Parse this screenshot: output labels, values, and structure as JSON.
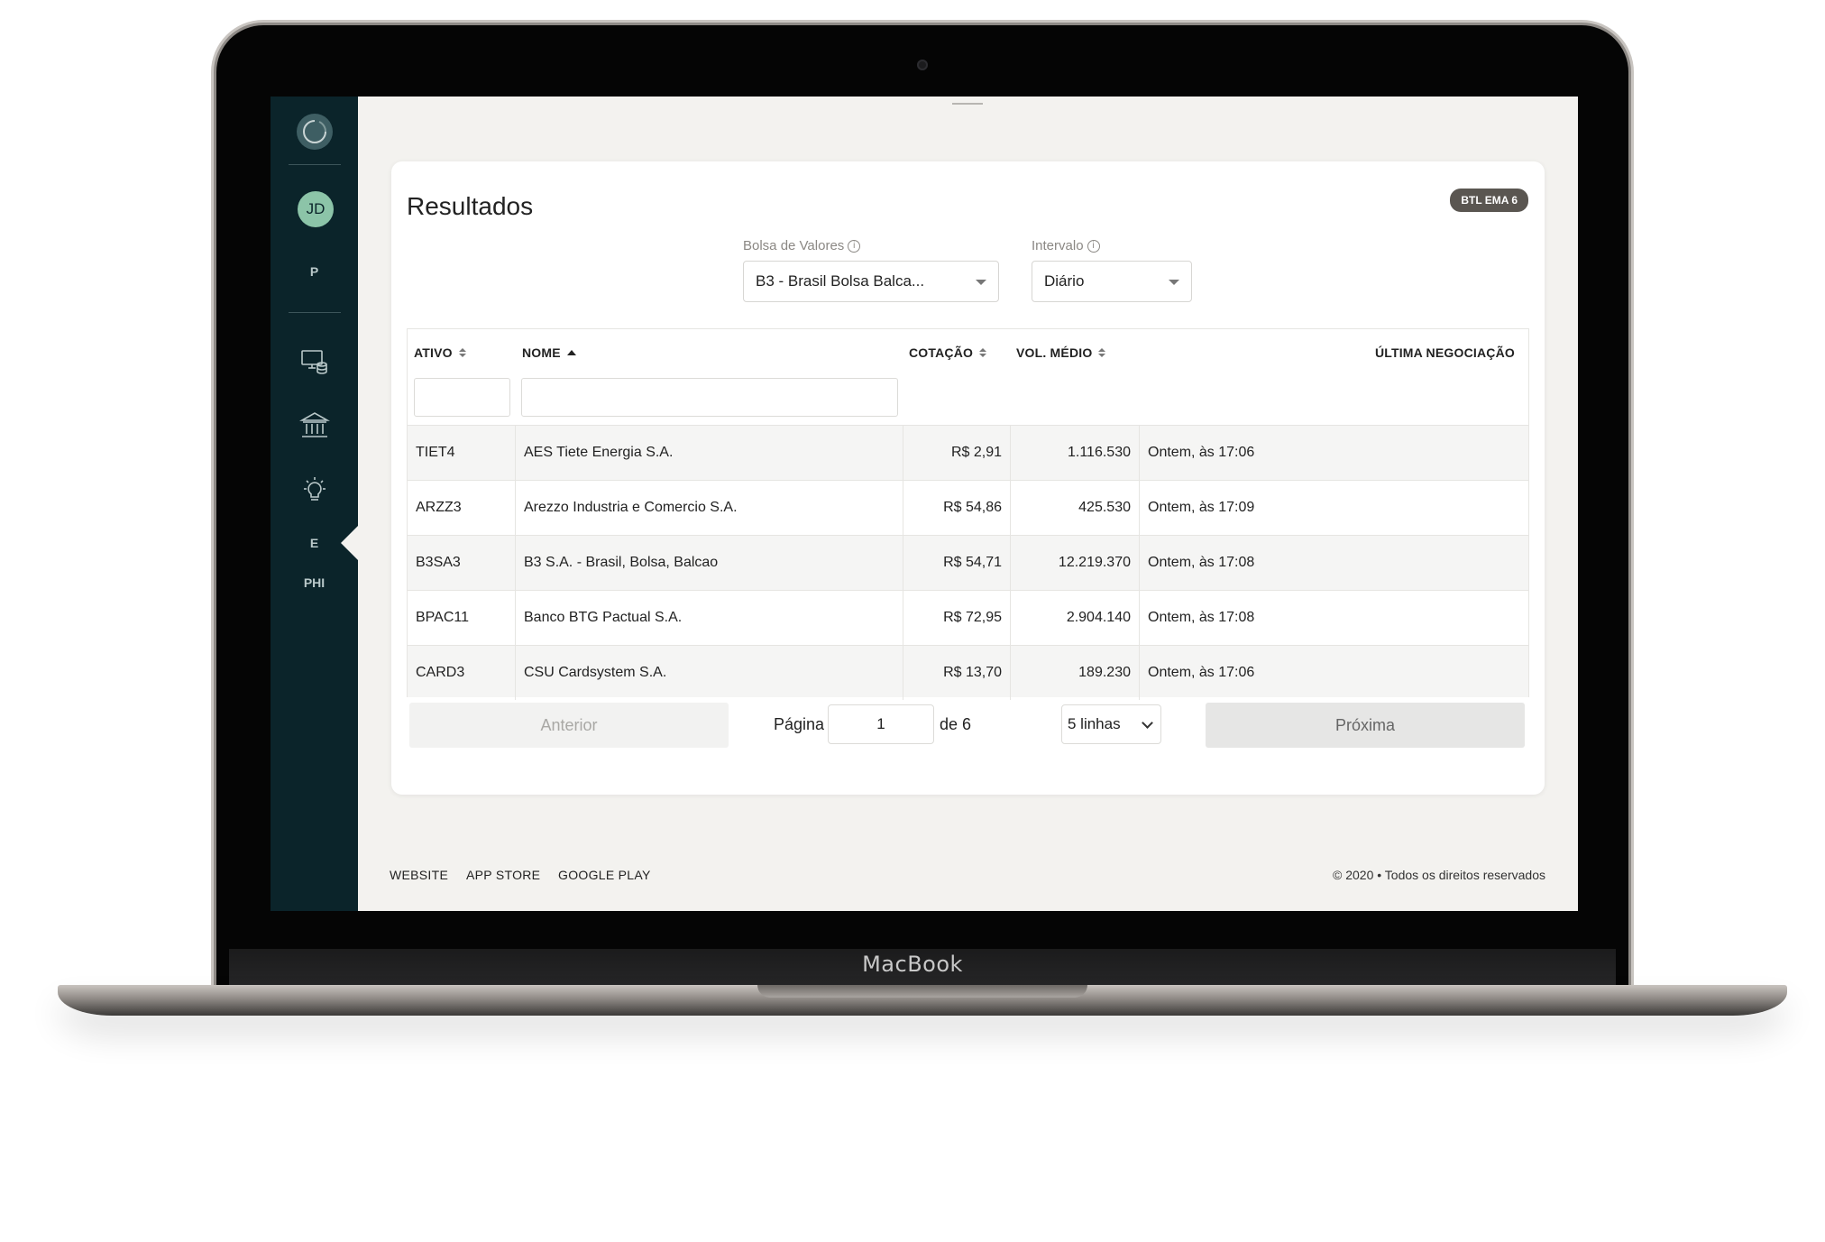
{
  "device": {
    "brand_label": "MacBook"
  },
  "sidebar": {
    "avatar_initials": "JD",
    "items": [
      {
        "label": "P"
      },
      {
        "icon": "monitor-coins-icon"
      },
      {
        "icon": "bank-icon"
      },
      {
        "icon": "lightbulb-icon"
      },
      {
        "label": "E"
      },
      {
        "label": "PHI"
      }
    ]
  },
  "card": {
    "title": "Resultados",
    "badge": "BTL EMA 6",
    "exchange": {
      "label": "Bolsa de Valores",
      "value": "B3 - Brasil Bolsa Balca..."
    },
    "interval": {
      "label": "Intervalo",
      "value": "Diário"
    }
  },
  "table": {
    "columns": [
      "ATIVO",
      "NOME",
      "COTAÇÃO",
      "VOL. MÉDIO",
      "ÚLTIMA NEGOCIAÇÃO"
    ],
    "rows": [
      {
        "ativo": "TIET4",
        "nome": "AES Tiete Energia S.A.",
        "cotacao": "R$ 2,91",
        "volume": "1.116.530",
        "ultima": "Ontem, às 17:06"
      },
      {
        "ativo": "ARZZ3",
        "nome": "Arezzo Industria e Comercio S.A.",
        "cotacao": "R$ 54,86",
        "volume": "425.530",
        "ultima": "Ontem, às 17:09"
      },
      {
        "ativo": "B3SA3",
        "nome": "B3 S.A. - Brasil, Bolsa, Balcao",
        "cotacao": "R$ 54,71",
        "volume": "12.219.370",
        "ultima": "Ontem, às 17:08"
      },
      {
        "ativo": "BPAC11",
        "nome": "Banco BTG Pactual S.A.",
        "cotacao": "R$ 72,95",
        "volume": "2.904.140",
        "ultima": "Ontem, às 17:08"
      },
      {
        "ativo": "CARD3",
        "nome": "CSU Cardsystem S.A.",
        "cotacao": "R$ 13,70",
        "volume": "189.230",
        "ultima": "Ontem, às 17:06"
      }
    ]
  },
  "pagination": {
    "prev_label": "Anterior",
    "next_label": "Próxima",
    "page_label": "Página",
    "current_page": "1",
    "of_label": "de 6",
    "rows_option": "5 linhas"
  },
  "footer": {
    "links": [
      "WEBSITE",
      "APP STORE",
      "GOOGLE PLAY"
    ],
    "copyright": "© 2020 • Todos os direitos reservados"
  },
  "colors": {
    "sidebar_bg": "#0b242a",
    "avatar_bg": "#8cc4a8",
    "page_bg": "#f3f2ef",
    "badge_bg": "#5a5651"
  }
}
